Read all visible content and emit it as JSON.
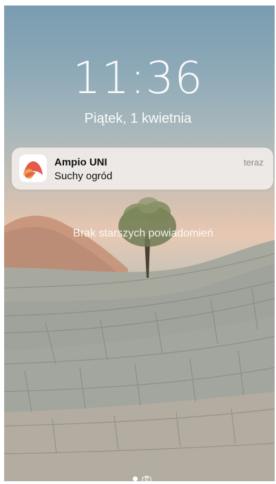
{
  "lock_screen": {
    "time": "11:36",
    "date": "Piątek, 1 kwietnia",
    "no_older_notifications": "Brak starszych powiadomień"
  },
  "notification": {
    "app_name": "Ampio UNI",
    "message": "Suchy ogród",
    "time": "teraz",
    "icon": "ampio-logo-icon"
  },
  "page_indicator": {
    "icons": [
      "page-dot-icon",
      "camera-icon"
    ]
  },
  "colors": {
    "ampio_red": "#e35a4a",
    "ampio_orange": "#f2a24a"
  }
}
